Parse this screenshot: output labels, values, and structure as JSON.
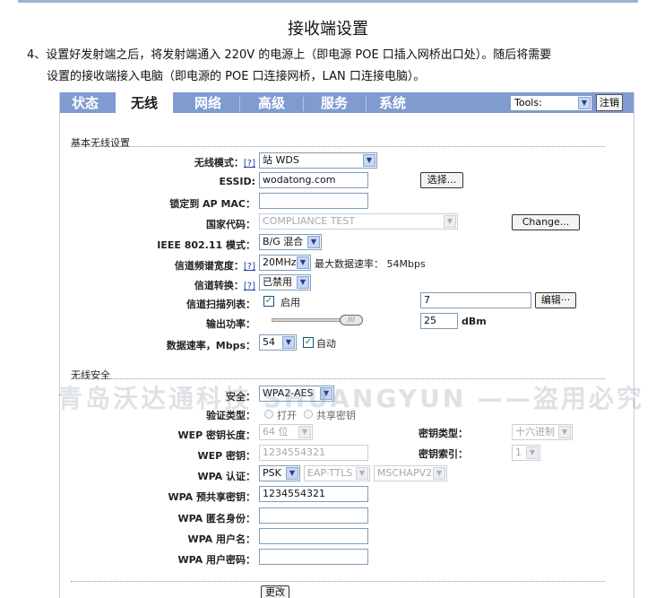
{
  "doc": {
    "title": "接收端设置",
    "para_line1": "4、设置好发射端之后，将发射端通入 220V 的电源上（即电源 POE 口插入网桥出口处）。随后将需要",
    "para_line2": "设置的接收端接入电脑（即电源的 POE 口连接网桥，LAN 口连接电脑）。"
  },
  "nav": {
    "tabs": [
      {
        "label": "状态"
      },
      {
        "label": "无线",
        "active": true
      },
      {
        "label": "网络"
      },
      {
        "label": "高级"
      },
      {
        "label": "服务"
      },
      {
        "label": "系统"
      }
    ],
    "tools_value": "Tools:",
    "logout_label": "注销",
    "bar_color": "#7f9bd0"
  },
  "basic": {
    "section_title": "基本无线设置",
    "help_mark": "[?]",
    "wireless_mode_label": "无线模式：",
    "wireless_mode_value": "站 WDS",
    "essid_label": "ESSID:",
    "essid_value": "wodatong.com",
    "select_button": "选择...",
    "lock_ap_mac_label": "锁定到 AP MAC：",
    "lock_ap_mac_value": "",
    "country_label": "国家代码：",
    "country_value": "COMPLIANCE TEST",
    "change_button": "Change...",
    "ieee_label": "IEEE 802.11 模式：",
    "ieee_value": "B/G 混合",
    "channel_width_label": "信道频谱宽度：",
    "channel_width_value": "20MHz",
    "max_rate_text": "最大数据速率： 54Mbps",
    "channel_shift_label": "信道转换：",
    "channel_shift_value": "已禁用",
    "scan_list_label": "信道扫描列表：",
    "scan_enable_label": "启用",
    "scan_enabled": true,
    "scan_list_value": "7",
    "edit_button": "编辑···",
    "output_power_label": "输出功率：",
    "output_power_value": "25",
    "output_power_unit": "dBm",
    "data_rate_label": "数据速率，Mbps：",
    "data_rate_value": "54",
    "auto_label": "自动",
    "auto_checked": true
  },
  "security": {
    "section_title": "无线安全",
    "security_label": "安全：",
    "security_value": "WPA2-AES",
    "auth_type_label": "验证类型：",
    "auth_open_label": "打开",
    "auth_shared_label": "共享密钥",
    "wep_key_length_label": "WEP 密钥长度：",
    "wep_key_length_value": "64 位",
    "key_type_label": "密钥类型：",
    "key_type_value": "十六进制",
    "wep_key_label": "WEP 密钥：",
    "wep_key_value": "1234554321",
    "key_index_label": "密钥索引：",
    "key_index_value": "1",
    "wpa_auth_label": "WPA 认证：",
    "wpa_auth_value": "PSK",
    "eap_value": "EAP-TTLS",
    "mschap_value": "MSCHAPV2",
    "wpa_psk_label": "WPA 预共享密钥：",
    "wpa_psk_value": "1234554321",
    "wpa_anon_label": "WPA 匿名身份：",
    "wpa_anon_value": "",
    "wpa_user_label": "WPA 用户名：",
    "wpa_user_value": "",
    "wpa_pass_label": "WPA 用户密码：",
    "wpa_pass_value": "",
    "submit_button": "更改"
  },
  "watermark_text": "青岛沃达通科技 SHUANGYUN ——盗用必究"
}
